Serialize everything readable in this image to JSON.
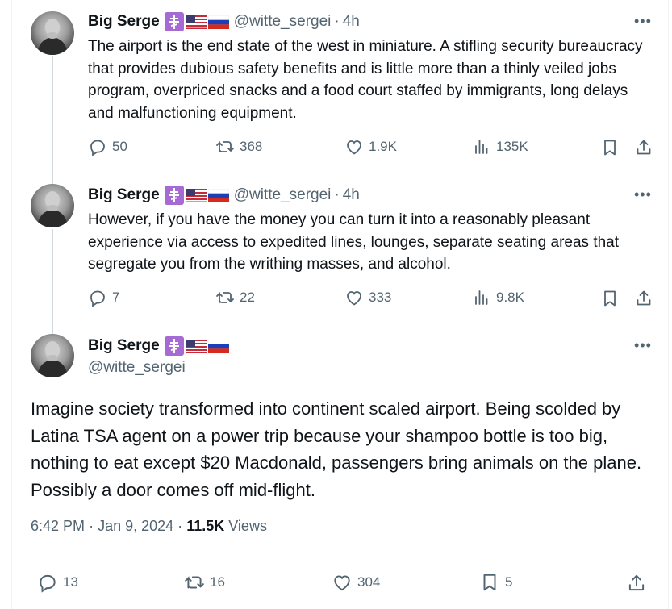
{
  "tweets": [
    {
      "name": "Big Serge",
      "handle": "@witte_sergei",
      "time": "4h",
      "text": "The airport is the end state of the west in miniature. A stifling security bureaucracy that provides dubious safety benefits and is little more than a thinly veiled jobs program, overpriced snacks and a food court staffed by immigrants, long delays and malfunctioning equipment.",
      "replies": "50",
      "reposts": "368",
      "likes": "1.9K",
      "views": "135K"
    },
    {
      "name": "Big Serge",
      "handle": "@witte_sergei",
      "time": "4h",
      "text": "However, if you have the money you can turn it into a reasonably pleasant experience via access to expedited lines, lounges, separate seating areas that segregate you from the writhing masses, and alcohol.",
      "replies": "7",
      "reposts": "22",
      "likes": "333",
      "views": "9.8K"
    }
  ],
  "main": {
    "name": "Big Serge",
    "handle": "@witte_sergei",
    "text": "Imagine society transformed into continent scaled airport. Being scolded by Latina TSA agent on a power trip because your shampoo bottle is too big, nothing to eat except $20 Macdonald, passengers bring animals on the plane. Possibly a door comes off mid-flight.",
    "time": "6:42 PM",
    "date": "Jan 9, 2024",
    "views_count": "11.5K",
    "views_label": "Views",
    "replies": "13",
    "reposts": "16",
    "likes": "304",
    "bookmarks": "5"
  },
  "separator": "·",
  "more_glyph": "•••",
  "icons": [
    "reply-icon",
    "repost-icon",
    "like-icon",
    "views-icon",
    "bookmark-icon",
    "share-icon",
    "more-icon"
  ],
  "colors": {
    "text": "#0f1419",
    "muted": "#536471",
    "thread_line": "#cfd9de",
    "badge_purple": "#a56ad4"
  }
}
